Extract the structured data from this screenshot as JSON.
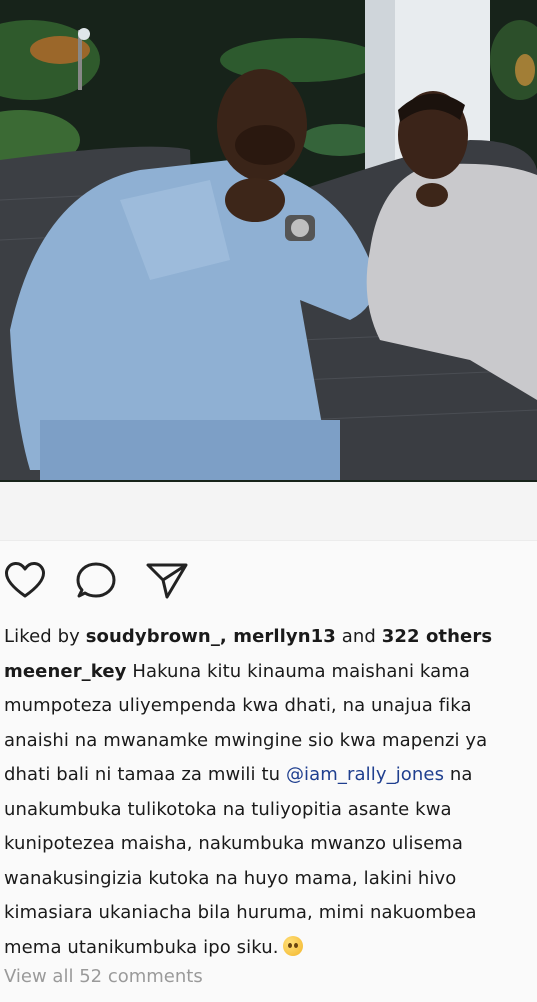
{
  "post": {
    "photo_alt": "",
    "actions": {
      "like_icon": "heart-icon",
      "comment_icon": "comment-icon",
      "share_icon": "send-icon"
    },
    "likes": {
      "prefix": "Liked by ",
      "users": "soudybrown_, merllyn13",
      "connector": " and ",
      "others": "322 others"
    },
    "caption": {
      "author": "meener_key",
      "lines": [
        " Hakuna kitu kinauma maishani kama",
        "mumpoteza uliyempenda kwa dhati, na unajua fika",
        "anaishi na mwanamke mwingine sio kwa mapenzi ya",
        "dhati bali ni tamaa za mwili tu ",
        "unakumbuka tulikotoka na tuliyopitia asante kwa",
        "kunipotezea maisha, nakumbuka mwanzo ulisema",
        "wanakusingizia kutoka na huyo mama, lakini hivo",
        "kimasiara ukaniacha bila huruma, mimi nakuombea",
        "mema utanikumbuka ipo siku."
      ],
      "mention": "@iam_rally_jones",
      "mention_tail": " na",
      "emoji": "rolling-eyes-emoji"
    },
    "view_comments": "View all 52 comments"
  }
}
